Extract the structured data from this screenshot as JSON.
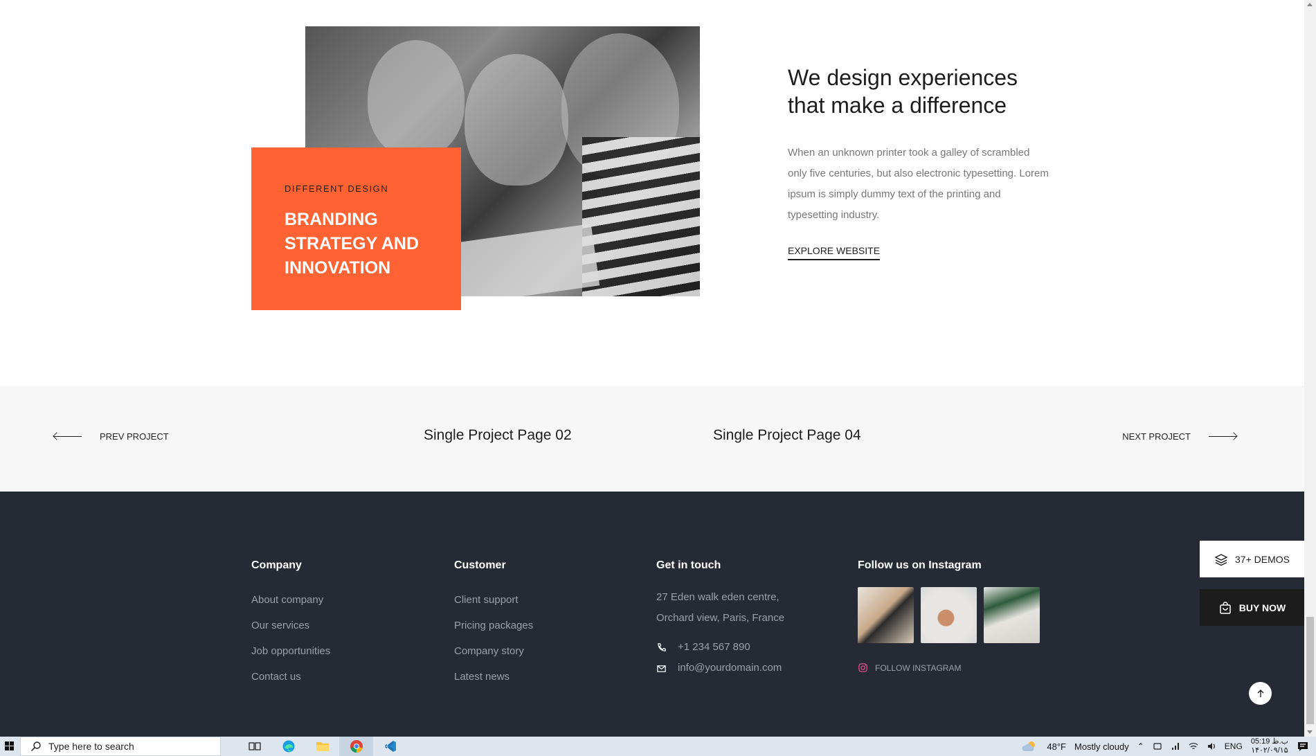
{
  "hero": {
    "eyebrow": "DIFFERENT DESIGN",
    "headline": "BRANDING STRATEGY AND INNOVATION",
    "heading": "We design experiences that make a difference",
    "description": "When an unknown printer took a galley of scrambled only five centuries, but also electronic typesetting. Lorem ipsum is simply dummy text of the printing and typesetting industry.",
    "cta": "EXPLORE WEBSITE",
    "accent_color": "#ff6333"
  },
  "project_nav": {
    "prev_label": "PREV PROJECT",
    "prev_title": "Single Project Page 02",
    "next_title": "Single Project Page 04",
    "next_label": "NEXT PROJECT"
  },
  "footer": {
    "background_color": "#262a35",
    "company": {
      "heading": "Company",
      "links": [
        "About company",
        "Our services",
        "Job opportunities",
        "Contact us"
      ]
    },
    "customer": {
      "heading": "Customer",
      "links": [
        "Client support",
        "Pricing packages",
        "Company story",
        "Latest news"
      ]
    },
    "contact": {
      "heading": "Get in touch",
      "address_line1": "27 Eden walk eden centre,",
      "address_line2": "Orchard view, Paris, France",
      "phone": "+1 234 567 890",
      "email": "info@yourdomain.com"
    },
    "instagram": {
      "heading": "Follow us on Instagram",
      "follow_label": "FOLLOW INSTAGRAM"
    }
  },
  "floating": {
    "demos_label": "37+ DEMOS",
    "buy_label": "BUY NOW"
  },
  "taskbar": {
    "search_placeholder": "Type here to search",
    "weather_temp": "48°F",
    "weather_text": "Mostly cloudy",
    "language": "ENG",
    "time": "05:19 ب.ظ",
    "date": "۱۴۰۲/۰۹/۱۵"
  }
}
